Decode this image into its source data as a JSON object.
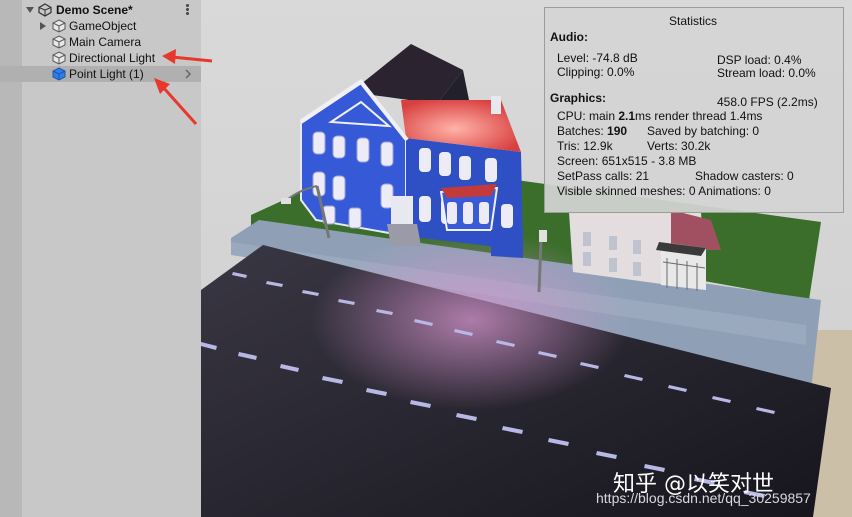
{
  "hierarchy": {
    "scene_title": "Demo Scene*",
    "items": [
      {
        "label": "GameObject"
      },
      {
        "label": "Main Camera"
      },
      {
        "label": "Directional Light"
      },
      {
        "label": "Point Light (1)"
      }
    ]
  },
  "stats": {
    "title": "Statistics",
    "audio_header": "Audio:",
    "level": "Level: -74.8 dB",
    "dsp_load": "DSP load: 0.4%",
    "clipping": "Clipping: 0.0%",
    "stream_load": "Stream load: 0.0%",
    "graphics_header": "Graphics:",
    "fps": "458.0 FPS (2.2ms)",
    "cpu_prefix": "CPU: main ",
    "cpu_main": "2.1",
    "cpu_suffix": "ms  render thread 1.4ms",
    "batches_label": "Batches: ",
    "batches_value": "190",
    "saved_batching": "Saved by batching: 0",
    "tris": "Tris: 12.9k",
    "verts": "Verts: 30.2k",
    "screen": "Screen: 651x515 - 3.8 MB",
    "setpass": "SetPass calls: 21",
    "shadow_casters": "Shadow casters: 0",
    "skinned": "Visible skinned meshes: 0  Animations: 0"
  },
  "watermark": {
    "zh": "知乎 @以笑对世",
    "url": "https://blog.csdn.net/qq_30259857"
  },
  "colors": {
    "selection": "#b0b0b0",
    "cube_icon_blue": "#1e6fd9",
    "annotation_arrow": "#e8372c",
    "house_blue": "#3659d8"
  }
}
